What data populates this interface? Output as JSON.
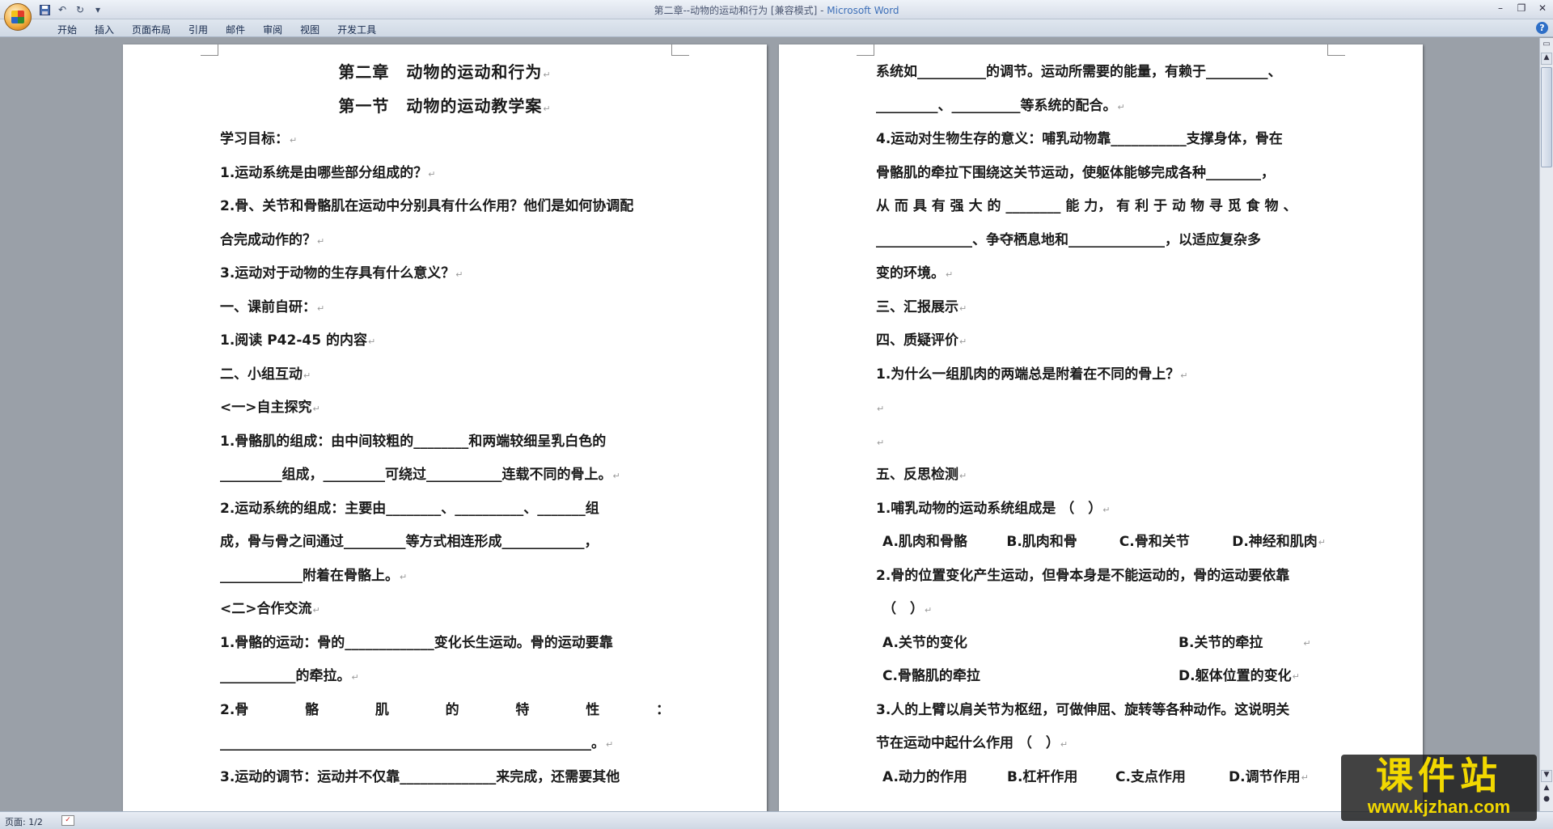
{
  "window": {
    "title_prefix": "第二章--动物的运动和行为 [兼容模式] - ",
    "title_app": "Microsoft Word"
  },
  "quick_access": [
    "save-icon",
    "undo-icon",
    "redo-icon",
    "customize-icon"
  ],
  "ribbon_tabs": [
    "开始",
    "插入",
    "页面布局",
    "引用",
    "邮件",
    "审阅",
    "视图",
    "开发工具"
  ],
  "page1": {
    "lines": [
      "第二章　动物的运动和行为",
      "第一节　动物的运动教学案",
      "学习目标：",
      "1.运动系统是由哪些部分组成的？",
      "2.骨、关节和骨骼肌在运动中分别具有什么作用？他们是如何协调配",
      "合完成动作的？",
      "3.运动对于动物的生存具有什么意义？",
      "一、课前自研：",
      "1.阅读 P42-45 的内容",
      "二、小组互动",
      "<一>自主探究",
      "1.骨骼肌的组成：由中间较粗的________和两端较细呈乳白色的",
      "_________组成，_________可绕过___________连载不同的骨上。",
      "2.运动系统的组成：主要由________、__________、_______组",
      "成，骨与骨之间通过_________等方式相连形成____________，",
      "____________附着在骨骼上。",
      "<二>合作交流",
      "1.骨骼的运动：骨的_____________变化长生运动。骨的运动要靠",
      "___________的牵拉。",
      "______________________________________________________。",
      "3.运动的调节：运动并不仅靠______________来完成，还需要其他"
    ],
    "spaced_line": [
      "2.骨",
      "骼",
      "肌",
      "的",
      "特",
      "性",
      "："
    ]
  },
  "page2": {
    "lines": [
      "系统如__________的调节。运动所需要的能量，有赖于_________、",
      "_________、__________等系统的配合。",
      "4.运动对生物生存的意义：哺乳动物靠___________支撑身体，骨在",
      "骨骼肌的牵拉下围绕这关节运动，使躯体能够完成各种________，",
      "从 而 具 有 强 大 的 ________ 能 力， 有 利 于 动 物 寻 觅 食 物 、",
      "______________、争夺栖息地和______________，以适应复杂多",
      "变的环境。",
      "三、汇报展示",
      "四、质疑评价",
      "1.为什么一组肌肉的两端总是附着在不同的骨上？",
      "",
      "",
      "五、反思检测",
      "1.哺乳动物的运动系统组成是 （　）",
      "2.骨的位置变化产生运动，但骨本身是不能运动的，骨的运动要依靠",
      "（　）",
      "3.人的上臂以肩关节为枢纽，可做伸屈、旋转等各种动作。这说明关",
      "节在运动中起什么作用 （　）"
    ],
    "q1_options": [
      "A.肌肉和骨骼",
      "B.肌肉和骨",
      "C.骨和关节",
      "D.神经和肌肉"
    ],
    "q2_options_row1": [
      "A.关节的变化",
      "B.关节的牵拉"
    ],
    "q2_options_row2": [
      "C.骨骼肌的牵拉",
      "D.躯体位置的变化"
    ],
    "q3_options": [
      "A.动力的作用",
      "B.杠杆作用",
      "C.支点作用",
      "D.调节作用"
    ]
  },
  "status": {
    "page_label": "页面: 1/2"
  },
  "watermark": {
    "text": "课件站",
    "url": "www.kjzhan.com"
  }
}
